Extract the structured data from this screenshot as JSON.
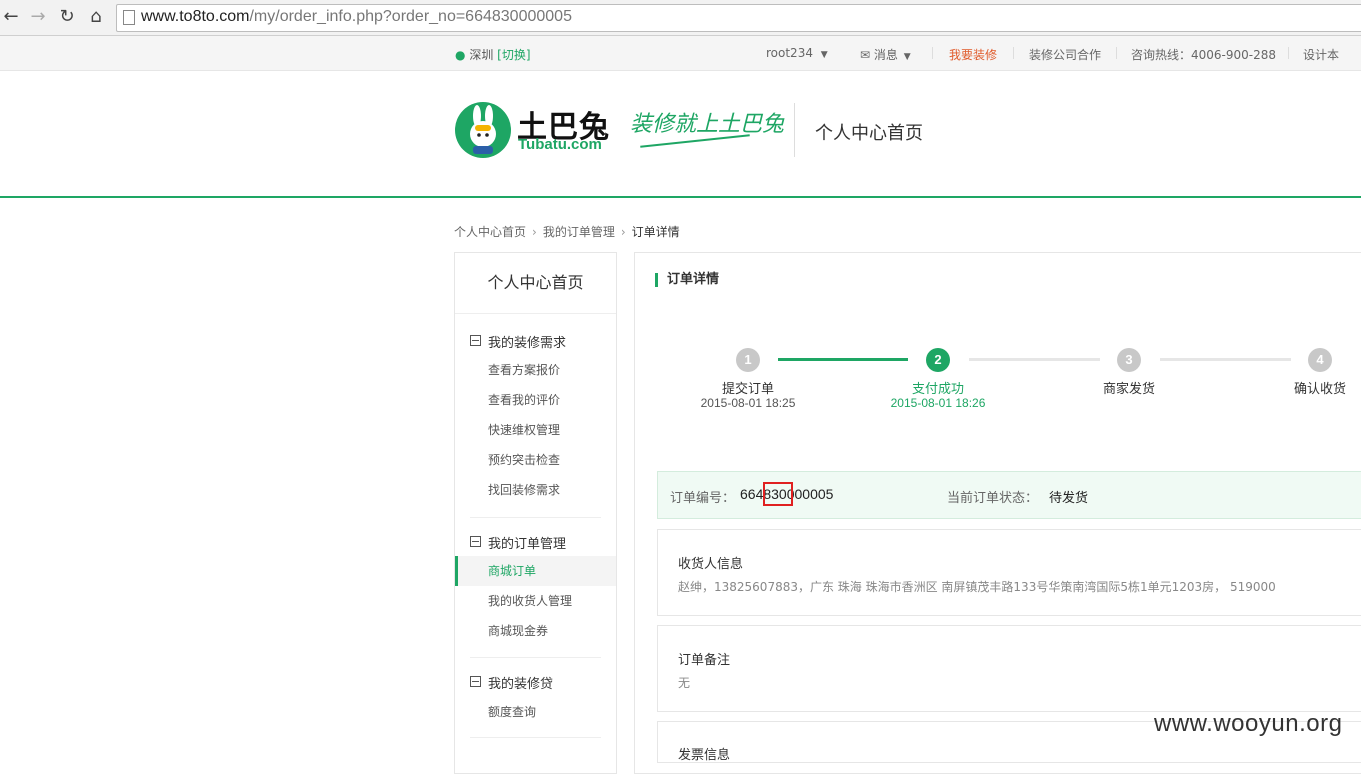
{
  "browser": {
    "url_host": "www.to8to.com",
    "url_path": "/my/order_info.php?order_no=664830000005"
  },
  "topbar": {
    "city": "深圳",
    "switch": "[切换]",
    "user": "root234",
    "message": "消息",
    "decorate": "我要装修",
    "partner": "装修公司合作",
    "hotline": "咨询热线：4006-900-288",
    "design": "设计本"
  },
  "header": {
    "logo_cn": "土巴兔",
    "logo_en": "Tubatu.com",
    "slogan": "装修就上土巴兔",
    "title": "个人中心首页"
  },
  "breadcrumb": {
    "home": "个人中心首页",
    "orders": "我的订单管理",
    "current": "订单详情"
  },
  "sidebar": {
    "title": "个人中心首页",
    "sections": [
      {
        "label": "我的装修需求",
        "items": [
          "查看方案报价",
          "查看我的评价",
          "快速维权管理",
          "预约突击检查",
          "找回装修需求"
        ]
      },
      {
        "label": "我的订单管理",
        "items": [
          "商城订单",
          "我的收货人管理",
          "商城现金券"
        ]
      },
      {
        "label": "我的装修贷",
        "items": [
          "额度查询"
        ]
      }
    ]
  },
  "main": {
    "title": "订单详情",
    "steps": [
      {
        "num": "1",
        "label": "提交订单",
        "time": "2015-08-01 18:25"
      },
      {
        "num": "2",
        "label": "支付成功",
        "time": "2015-08-01 18:26"
      },
      {
        "num": "3",
        "label": "商家发货",
        "time": ""
      },
      {
        "num": "4",
        "label": "确认收货",
        "time": ""
      }
    ],
    "order_no_label": "订单编号：",
    "order_no": "664830000005",
    "status_label": "当前订单状态：",
    "status": "待发货",
    "receiver_title": "收货人信息",
    "receiver_text": "赵绅，13825607883，广东 珠海 珠海市香洲区 南屏镇茂丰路133号华策南湾国际5栋1单元1203房， 519000",
    "remark_title": "订单备注",
    "remark_text": "无",
    "invoice_title": "发票信息"
  },
  "watermark": "www.wooyun.org",
  "colors": {
    "brand_green": "#1ea664",
    "highlight_red": "#e02020",
    "decorate_orange": "#e05a2a"
  }
}
